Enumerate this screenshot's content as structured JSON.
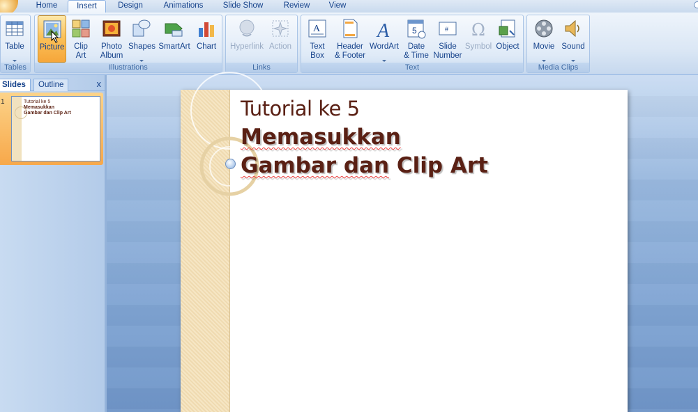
{
  "tabs": [
    "Home",
    "Insert",
    "Design",
    "Animations",
    "Slide Show",
    "Review",
    "View"
  ],
  "active_tab": "Insert",
  "ribbon": {
    "groups": [
      {
        "label": "Tables",
        "buttons": [
          {
            "label": "Table",
            "caret": true
          }
        ]
      },
      {
        "label": "Illustrations",
        "buttons": [
          {
            "label": "Picture",
            "pressed": true
          },
          {
            "label": "Clip\nArt"
          },
          {
            "label": "Photo\nAlbum",
            "caret": true
          },
          {
            "label": "Shapes",
            "caret": true
          },
          {
            "label": "SmartArt"
          },
          {
            "label": "Chart"
          }
        ]
      },
      {
        "label": "Links",
        "buttons": [
          {
            "label": "Hyperlink",
            "disabled": true
          },
          {
            "label": "Action",
            "disabled": true
          }
        ]
      },
      {
        "label": "Text",
        "buttons": [
          {
            "label": "Text\nBox"
          },
          {
            "label": "Header\n& Footer"
          },
          {
            "label": "WordArt",
            "caret": true
          },
          {
            "label": "Date\n& Time"
          },
          {
            "label": "Slide\nNumber"
          },
          {
            "label": "Symbol",
            "disabled": true
          },
          {
            "label": "Object"
          }
        ]
      },
      {
        "label": "Media Clips",
        "buttons": [
          {
            "label": "Movie",
            "caret": true
          },
          {
            "label": "Sound",
            "caret": true
          }
        ]
      }
    ]
  },
  "pane": {
    "tabs": [
      "Slides",
      "Outline"
    ],
    "close": "x",
    "slide_number": "1"
  },
  "slide": {
    "line1": "Tutorial ke 5",
    "line2": "Memasukkan",
    "line3a": "Gambar dan",
    "line3b": " Clip Art"
  },
  "thumb": {
    "line1": "Tutorial ke 5",
    "line2": "Memasukkan",
    "line3": "Gambar dan Clip Art"
  },
  "colors": {
    "title": "#5a2014",
    "accent": "#15428b"
  }
}
